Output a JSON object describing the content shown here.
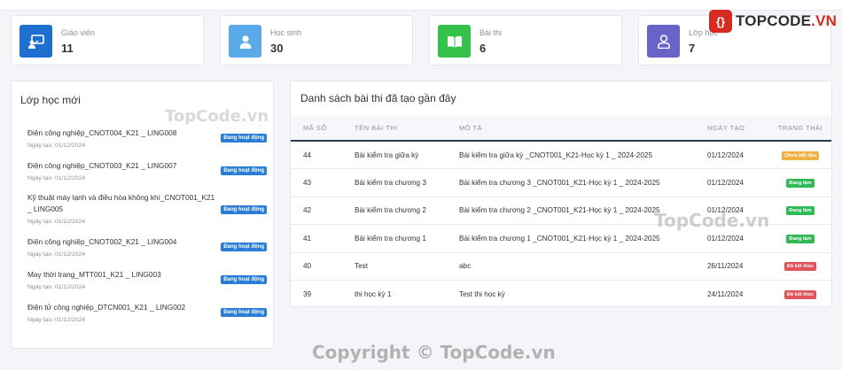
{
  "stats": [
    {
      "label": "Giáo viên",
      "value": "11",
      "color": "#1f6fd1",
      "icon": "teacher-icon"
    },
    {
      "label": "Học sinh",
      "value": "30",
      "color": "#5aa9e8",
      "icon": "student-icon"
    },
    {
      "label": "Bài thi",
      "value": "6",
      "color": "#34c24b",
      "icon": "book-icon"
    },
    {
      "label": "Lớp học",
      "value": "7",
      "color": "#6a63c7",
      "icon": "user-icon"
    }
  ],
  "brand": {
    "name": "TOPCODE",
    "tld": ".VN"
  },
  "classes": {
    "title": "Lớp học mới",
    "items": [
      {
        "name": "Điện công nghiệp_CNOT004_K21 _ LING008",
        "date": "Ngày tạo: 01/12/2024",
        "status": "Đang hoạt động"
      },
      {
        "name": "Điện công nghiệp_CNOT003_K21 _ LING007",
        "date": "Ngày tạo: 01/12/2024",
        "status": "Đang hoạt động"
      },
      {
        "name": "Kỹ thuật máy lạnh và điều hòa không khí_CNOT001_K21 _ LING005",
        "date": "Ngày tạo: 01/12/2024",
        "status": "Đang hoạt động"
      },
      {
        "name": "Điện công nghiệp_CNOT002_K21 _ LING004",
        "date": "Ngày tạo: 01/12/2024",
        "status": "Đang hoạt động"
      },
      {
        "name": "May thời trang_MTT001_K21 _ LING003",
        "date": "Ngày tạo: 01/12/2024",
        "status": "Đang hoạt động"
      },
      {
        "name": "Điện tử công nghiệp_DTCN001_K21 _ LING002",
        "date": "Ngày tạo: 01/12/2024",
        "status": "Đang hoạt động"
      }
    ]
  },
  "exams": {
    "title": "Danh sách bài thi đã tạo gần đây",
    "columns": [
      "MÃ SỐ",
      "TÊN BÀI THI",
      "MÔ TẢ",
      "NGÀY TẠO",
      "TRẠNG THÁI"
    ],
    "rows": [
      {
        "id": "44",
        "name": "Bài kiểm tra giữa kỳ",
        "desc": "Bài kiểm tra giữa kỳ _CNOT001_K21-Học kỳ 1 _ 2024-2025",
        "date": "01/12/2024",
        "status": "Chưa bắt đầu",
        "color": "#f0b042"
      },
      {
        "id": "43",
        "name": "Bài kiểm tra chương 3",
        "desc": "Bài kiểm tra chương 3 _CNOT001_K21-Học kỳ 1 _ 2024-2025",
        "date": "01/12/2024",
        "status": "Đang làm",
        "color": "#2fb957"
      },
      {
        "id": "42",
        "name": "Bài kiểm tra chương 2",
        "desc": "Bài kiểm tra chương 2 _CNOT001_K21-Học kỳ 1 _ 2024-2025",
        "date": "01/12/2024",
        "status": "Đang làm",
        "color": "#2fb957"
      },
      {
        "id": "41",
        "name": "Bài kiểm tra chương 1",
        "desc": "Bài kiểm tra chương 1 _CNOT001_K21-Học kỳ 1 _ 2024-2025",
        "date": "01/12/2024",
        "status": "Đang làm",
        "color": "#2fb957"
      },
      {
        "id": "40",
        "name": "Test",
        "desc": "abc",
        "date": "26/11/2024",
        "status": "Đã kết thúc",
        "color": "#e0535a"
      },
      {
        "id": "39",
        "name": "thi học kỳ 1",
        "desc": "Test thi học kỳ",
        "date": "24/11/2024",
        "status": "Đã kết thúc",
        "color": "#e0535a"
      }
    ]
  },
  "watermarks": [
    "TopCode.vn",
    "TopCode.vn",
    "Copyright © TopCode.vn"
  ]
}
